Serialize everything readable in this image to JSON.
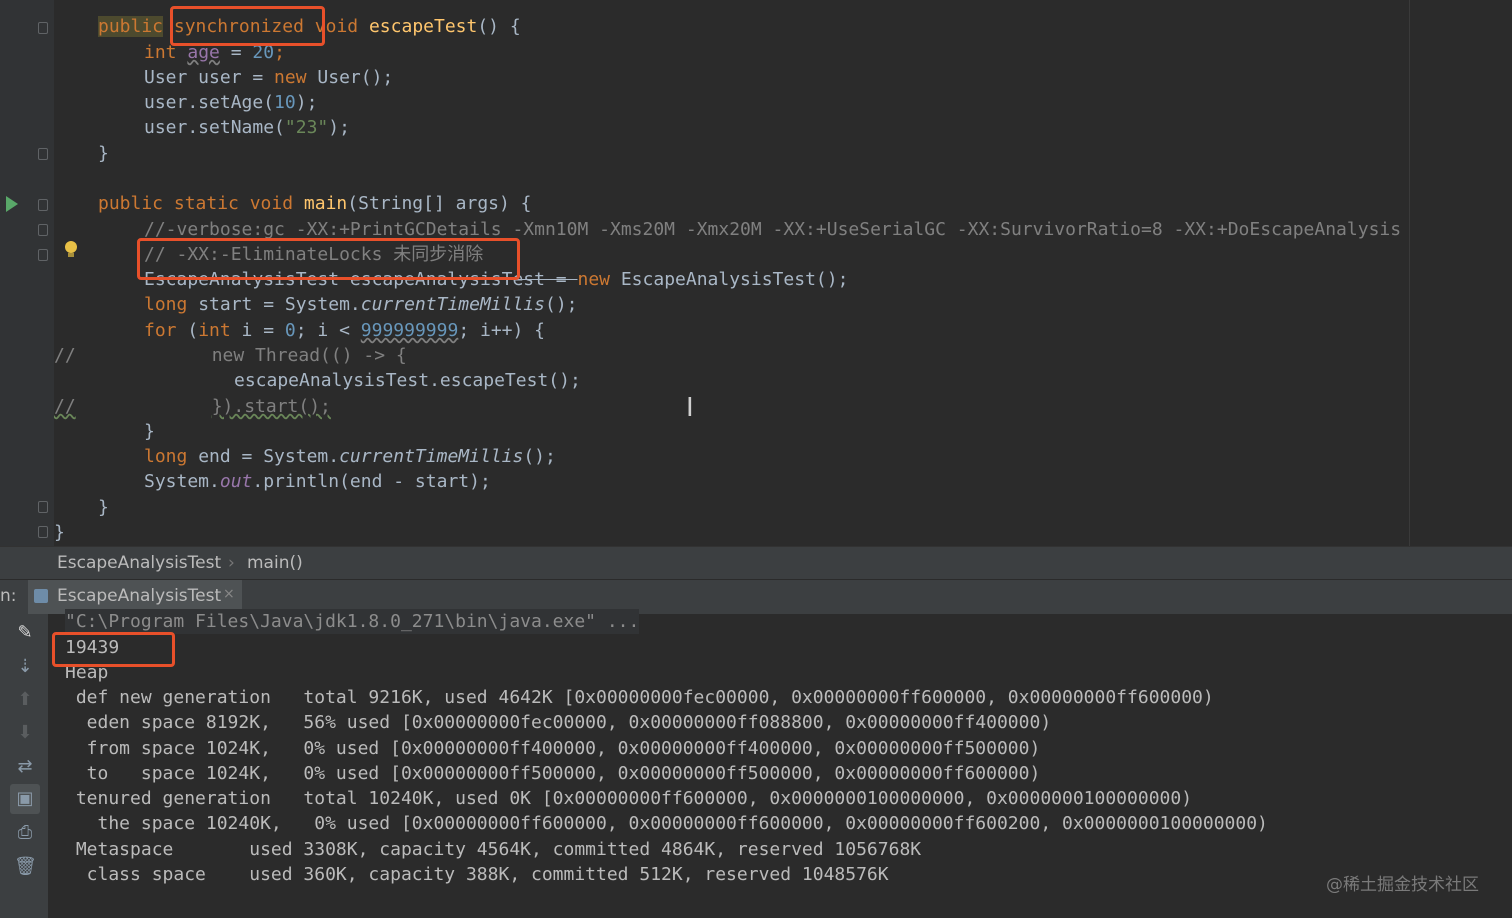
{
  "code": {
    "l1": {
      "kw_public": "public",
      "kw_sync": "synchronized",
      "kw_void": "void",
      "fn": "escapeTest",
      "rest": "() {"
    },
    "l2": {
      "kw": "int",
      "var": "age",
      "op": " = ",
      "num": "20",
      "semi": ";"
    },
    "l3": {
      "plain": "User user = ",
      "kw": "new",
      "rest": "User();"
    },
    "l4": {
      "plain": "user.setAge(",
      "num": "10",
      "rest": ");"
    },
    "l5": {
      "plain": "user.setName(",
      "str": "\"23\"",
      "rest": ");"
    },
    "l6": {
      "plain": "}"
    },
    "l8": {
      "kw": "public static void",
      "fn": "main",
      "rest": "(String[] args) {"
    },
    "l9": {
      "cmt": "//-verbose:gc -XX:+PrintGCDetails -Xmn10M -Xms20M -Xmx20M -XX:+UseSerialGC -XX:SurvivorRatio=8 -XX:+DoEscapeAnalysis"
    },
    "l10": {
      "cmt": "// -XX:-EliminateLocks 未同步消除"
    },
    "l11": {
      "plain": "EscapeAnalysisTest escapeAnalysisTest = ",
      "kw": "new",
      "rest": "EscapeAnalysisTest();"
    },
    "l12": {
      "kw": "long",
      "plain": " start = System.",
      "it": "currentTimeMillis",
      "rest": "();"
    },
    "l13": {
      "kw": "for",
      "plain1": " (",
      "kw2": "int",
      "plain2": " i = ",
      "num": "0",
      "plain3": "; i < ",
      "num2": "999999999",
      "plain4": "; i++) {"
    },
    "l14": {
      "cmt_prefix": "//",
      "cmt": "new Thread(() -> {"
    },
    "l15": {
      "plain": "escapeAnalysisTest.escapeTest();"
    },
    "l16": {
      "cmt_prefix": "//",
      "cmt": "}).start();"
    },
    "l17": {
      "plain": "}"
    },
    "l18": {
      "kw": "long",
      "plain": " end = System.",
      "it": "currentTimeMillis",
      "rest": "();"
    },
    "l19": {
      "plain": "System.",
      "fld": "out",
      "rest": ".println(end - start);"
    },
    "l20": {
      "plain": "}"
    },
    "l21": {
      "plain": "}"
    }
  },
  "breadcrumb": {
    "class_name": "EscapeAnalysisTest",
    "separator": "›",
    "method": "main()"
  },
  "run_tab": {
    "prefix": "n:",
    "label": "EscapeAnalysisTest",
    "close": "×"
  },
  "tools": [
    "pencil-icon",
    "sort-down-icon",
    "arrow-up-icon",
    "arrow-down-icon",
    "soft-wrap-icon",
    "scroll-to-end-icon",
    "print-icon",
    "trash-icon"
  ],
  "console": {
    "cmd": "\"C:\\Program Files\\Java\\jdk1.8.0_271\\bin\\java.exe\" ...",
    "lines": [
      "19439",
      "Heap",
      " def new generation   total 9216K, used 4642K [0x00000000fec00000, 0x00000000ff600000, 0x00000000ff600000)",
      "  eden space 8192K,   56% used [0x00000000fec00000, 0x00000000ff088800, 0x00000000ff400000)",
      "  from space 1024K,   0% used [0x00000000ff400000, 0x00000000ff400000, 0x00000000ff500000)",
      "  to   space 1024K,   0% used [0x00000000ff500000, 0x00000000ff500000, 0x00000000ff600000)",
      " tenured generation   total 10240K, used 0K [0x00000000ff600000, 0x0000000100000000, 0x0000000100000000)",
      "   the space 10240K,   0% used [0x00000000ff600000, 0x00000000ff600000, 0x00000000ff600200, 0x0000000100000000)",
      " Metaspace       used 3308K, capacity 4564K, committed 4864K, reserved 1056768K",
      "  class space    used 360K, capacity 388K, committed 512K, reserved 1048576K"
    ]
  },
  "watermark": "@稀土掘金技术社区",
  "colors": {
    "highlight_box": "#e8502a",
    "keyword": "#cc7832",
    "function": "#ffc66d",
    "number": "#6897bb",
    "string": "#6a8759",
    "comment": "#808080"
  }
}
